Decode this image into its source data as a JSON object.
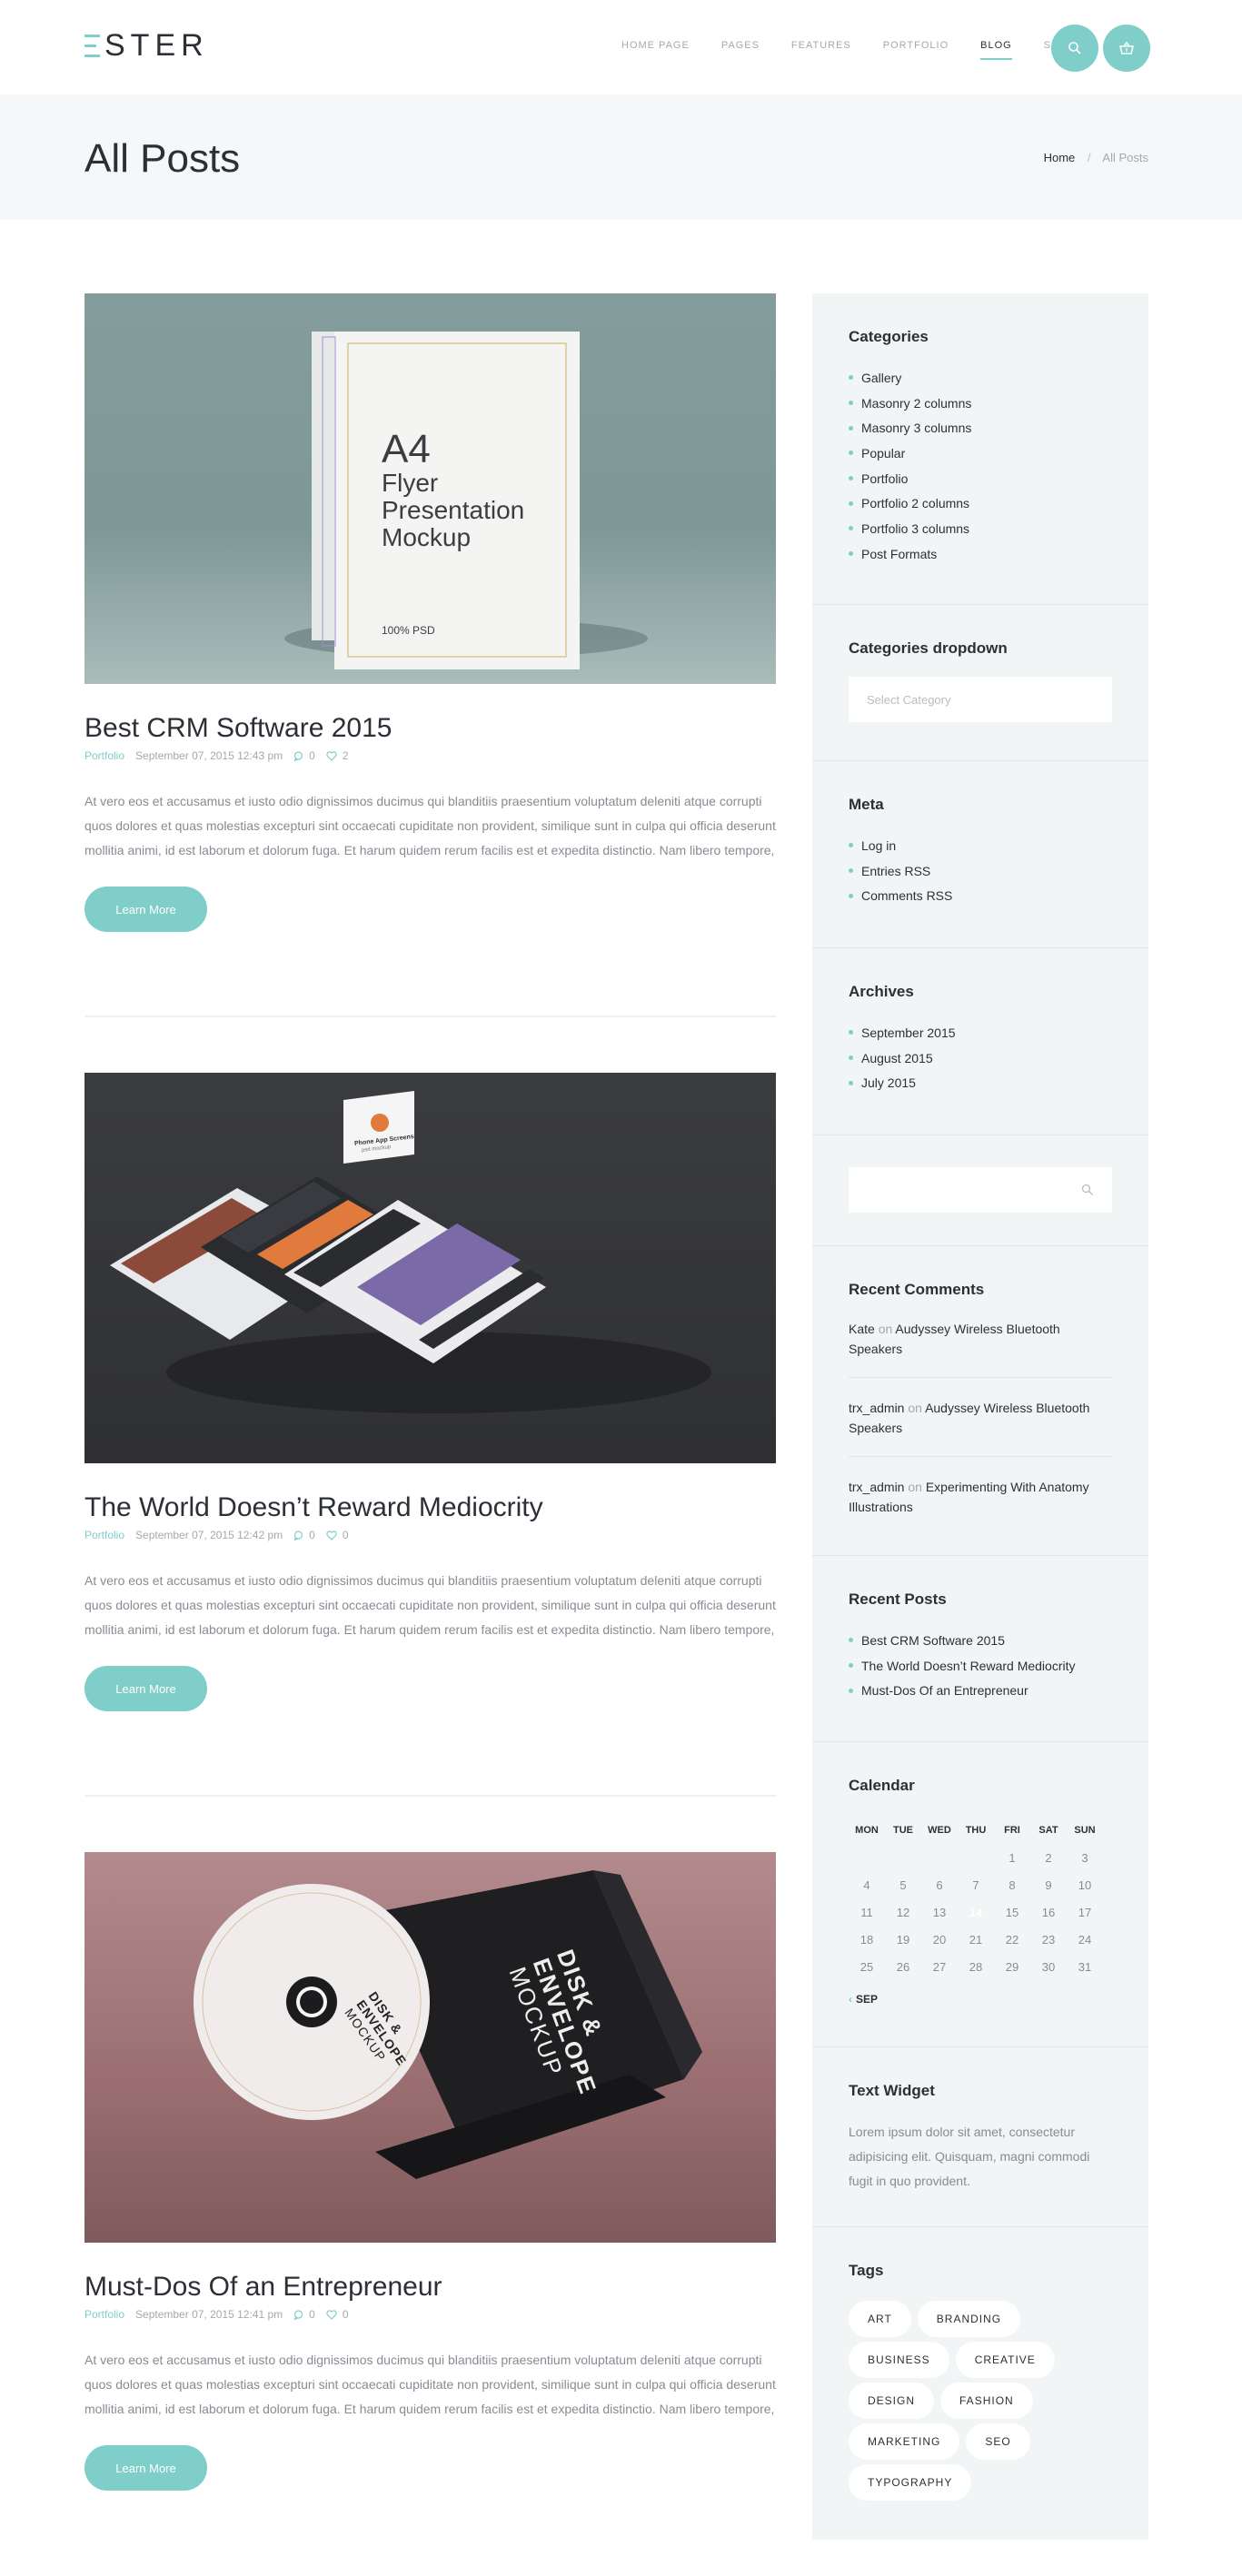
{
  "brand": {
    "logo_text": "STER",
    "accent": "#7fcec9"
  },
  "nav": {
    "items": [
      {
        "label": "HOME PAGE"
      },
      {
        "label": "PAGES"
      },
      {
        "label": "FEATURES"
      },
      {
        "label": "PORTFOLIO"
      },
      {
        "label": "BLOG"
      },
      {
        "label": "SHOP"
      }
    ],
    "active": "BLOG",
    "icons": [
      "search-icon",
      "basket-icon"
    ]
  },
  "titlebar": {
    "title": "All Posts",
    "breadcrumb": {
      "home": "Home",
      "separator": "/",
      "current": "All Posts"
    }
  },
  "posts": [
    {
      "title": "Best CRM Software 2015",
      "category": "Portfolio",
      "date": "September 07, 2015 12:43 pm",
      "comments": "0",
      "likes": "2",
      "image_text": {
        "line1": "A4",
        "line2": "Flyer",
        "line3": "Presentation",
        "line4": "Mockup",
        "footer": "100% PSD"
      },
      "excerpt": "At vero eos et accusamus et iusto odio dignissimos ducimus qui blanditiis praesentium voluptatum deleniti atque corrupti quos dolores et quas molestias excepturi sint occaecati cupiditate non provident, similique sunt in culpa qui officia deserunt mollitia animi, id est laborum et dolorum fuga. Et harum quidem rerum facilis est et expedita distinctio. Nam libero tempore,",
      "button": "Learn More"
    },
    {
      "title": "The World Doesn’t Reward Mediocrity",
      "category": "Portfolio",
      "date": "September 07, 2015 12:42 pm",
      "comments": "0",
      "likes": "0",
      "image_text": {
        "card_title": "Phone App Screens",
        "card_sub": "psd mockup"
      },
      "excerpt": "At vero eos et accusamus et iusto odio dignissimos ducimus qui blanditiis praesentium voluptatum deleniti atque corrupti quos dolores et quas molestias excepturi sint occaecati cupiditate non provident, similique sunt in culpa qui officia deserunt mollitia animi, id est laborum et dolorum fuga. Et harum quidem rerum facilis est et expedita distinctio. Nam libero tempore,",
      "button": "Learn More"
    },
    {
      "title": "Must-Dos Of an Entrepreneur",
      "category": "Portfolio",
      "date": "September 07, 2015 12:41 pm",
      "comments": "0",
      "likes": "0",
      "image_text": {
        "line1": "DISK &",
        "line2": "ENVELOPE",
        "line3": "MOCKUP"
      },
      "excerpt": "At vero eos et accusamus et iusto odio dignissimos ducimus qui blanditiis praesentium voluptatum deleniti atque corrupti quos dolores et quas molestias excepturi sint occaecati cupiditate non provident, similique sunt in culpa qui officia deserunt mollitia animi, id est laborum et dolorum fuga. Et harum quidem rerum facilis est et expedita distinctio. Nam libero tempore,",
      "button": "Learn More"
    }
  ],
  "sidebar": {
    "categories": {
      "title": "Categories",
      "items": [
        "Gallery",
        "Masonry 2 columns",
        "Masonry 3 columns",
        "Popular",
        "Portfolio",
        "Portfolio 2 columns",
        "Portfolio 3 columns",
        "Post Formats"
      ]
    },
    "categories_dropdown": {
      "title": "Categories dropdown",
      "placeholder": "Select Category"
    },
    "meta": {
      "title": "Meta",
      "items": [
        "Log in",
        "Entries RSS",
        "Comments RSS"
      ]
    },
    "archives": {
      "title": "Archives",
      "items": [
        "September 2015",
        "August 2015",
        "July 2015"
      ]
    },
    "recent_comments": {
      "title": "Recent Comments",
      "items": [
        {
          "author": "Kate",
          "on": "on",
          "post": "Audyssey Wireless Bluetooth Speakers"
        },
        {
          "author": "trx_admin",
          "on": "on",
          "post": "Audyssey Wireless Bluetooth Speakers"
        },
        {
          "author": "trx_admin",
          "on": "on",
          "post": "Experimenting With Anatomy Illustrations"
        }
      ]
    },
    "recent_posts": {
      "title": "Recent Posts",
      "items": [
        "Best CRM Software 2015",
        "The World Doesn’t Reward Mediocrity",
        "Must-Dos Of an Entrepreneur"
      ]
    },
    "calendar": {
      "title": "Calendar",
      "days": [
        "MON",
        "TUE",
        "WED",
        "THU",
        "FRI",
        "SAT",
        "SUN"
      ],
      "weeks": [
        [
          "",
          "",
          "",
          "",
          "1",
          "2",
          "3"
        ],
        [
          "4",
          "5",
          "6",
          "7",
          "8",
          "9",
          "10"
        ],
        [
          "11",
          "12",
          "13",
          "14",
          "15",
          "16",
          "17"
        ],
        [
          "18",
          "19",
          "20",
          "21",
          "22",
          "23",
          "24"
        ],
        [
          "25",
          "26",
          "27",
          "28",
          "29",
          "30",
          "31"
        ]
      ],
      "today": "14",
      "prev": "SEP"
    },
    "text_widget": {
      "title": "Text Widget",
      "text": "Lorem ipsum dolor sit amet, consectetur adipisicing elit. Quisquam, magni commodi fugit in quo provident."
    },
    "tags": {
      "title": "Tags",
      "items": [
        "ART",
        "BRANDING",
        "BUSINESS",
        "CREATIVE",
        "DESIGN",
        "FASHION",
        "MARKETING",
        "SEO",
        "TYPOGRAPHY"
      ]
    }
  }
}
